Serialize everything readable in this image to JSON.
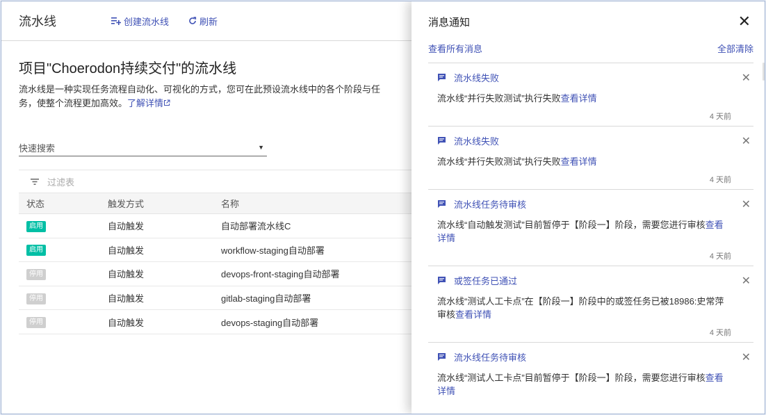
{
  "page": {
    "title": "流水线",
    "create_label": "创建流水线",
    "refresh_label": "刷新",
    "heading": "项目\"Choerodon持续交付\"的流水线",
    "description": "流水线是一种实现任务流程自动化、可视化的方式，您可在此预设流水线中的各个阶段与任务，使整个流程更加高效。",
    "learn_more": "了解详情",
    "search_placeholder": "快速搜索",
    "filter_placeholder": "过滤表",
    "columns": [
      "状态",
      "触发方式",
      "名称"
    ],
    "rows": [
      {
        "status": "启用",
        "enabled": true,
        "trigger": "自动触发",
        "name": "自动部署流水线C"
      },
      {
        "status": "启用",
        "enabled": true,
        "trigger": "自动触发",
        "name": "workflow-staging自动部署"
      },
      {
        "status": "停用",
        "enabled": false,
        "trigger": "自动触发",
        "name": "devops-front-staging自动部署"
      },
      {
        "status": "停用",
        "enabled": false,
        "trigger": "自动触发",
        "name": "gitlab-staging自动部署"
      },
      {
        "status": "停用",
        "enabled": false,
        "trigger": "自动触发",
        "name": "devops-staging自动部署"
      }
    ]
  },
  "drawer": {
    "title": "消息通知",
    "view_all": "查看所有消息",
    "clear_all": "全部清除",
    "detail_link": "查看详情",
    "notifications": [
      {
        "title": "流水线失败",
        "text": "流水线“并行失败测试”执行失败",
        "time": "4 天前"
      },
      {
        "title": "流水线失败",
        "text": "流水线“并行失败测试”执行失败",
        "time": "4 天前"
      },
      {
        "title": "流水线任务待审核",
        "text": "流水线“自动触发测试”目前暂停于【阶段一】阶段，需要您进行审核",
        "time": "4 天前"
      },
      {
        "title": "或签任务已通过",
        "text": "流水线“测试人工卡点”在【阶段一】阶段中的或签任务已被18986:史常萍审核",
        "time": "4 天前"
      },
      {
        "title": "流水线任务待审核",
        "text": "流水线“测试人工卡点”目前暂停于【阶段一】阶段，需要您进行审核",
        "time": ""
      }
    ]
  },
  "colors": {
    "accent": "#3f51b5",
    "enabled": "#00bfa5",
    "disabled": "#cfcfcf"
  }
}
